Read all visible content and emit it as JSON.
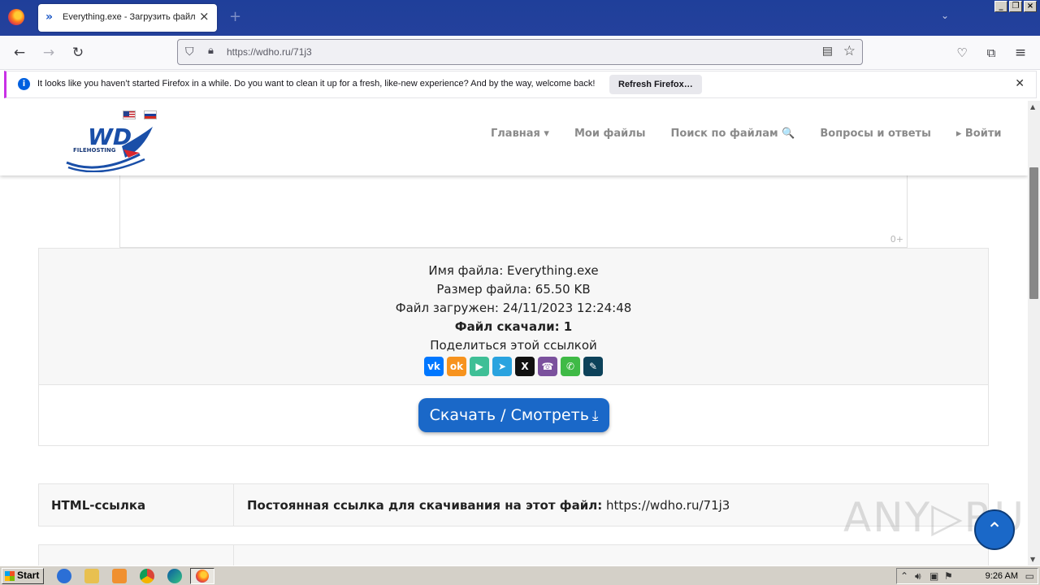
{
  "browser": {
    "tab_title": "Everything.exe - Загрузить файл",
    "url": "https://wdho.ru/71j3",
    "notification": {
      "message": "It looks like you haven’t started Firefox in a while. Do you want to clean it up for a fresh, like-new experience? And by the way, welcome back!",
      "button": "Refresh Firefox…"
    }
  },
  "site": {
    "logo_text": "WD",
    "logo_sub": "FILEHOSTING",
    "menu": [
      {
        "label": "Главная ▾"
      },
      {
        "label": "Мои файлы"
      },
      {
        "label": "Поиск по файлам 🔍"
      },
      {
        "label": "Вопросы и ответы"
      },
      {
        "label": "▸ Войти"
      }
    ],
    "ad_age": "0+"
  },
  "file": {
    "name_line": "Имя файла: Everything.exe",
    "size_line": "Размер файла: 65.50 KB",
    "uploaded_line": "Файл загружен: 24/11/2023 12:24:48",
    "downloads_line": "Файл скачали: 1",
    "share_label": "Поделиться этой ссылкой"
  },
  "share_buttons": [
    {
      "name": "vk",
      "glyph": "vk",
      "color": "#0077ff"
    },
    {
      "name": "odnoklassniki",
      "glyph": "ok",
      "color": "#f7931e"
    },
    {
      "name": "yandex-messenger",
      "glyph": "▶",
      "color": "#3fbf96"
    },
    {
      "name": "telegram",
      "glyph": "➤",
      "color": "#2aa3df"
    },
    {
      "name": "x",
      "glyph": "X",
      "color": "#111111"
    },
    {
      "name": "viber",
      "glyph": "☎",
      "color": "#7b519d"
    },
    {
      "name": "whatsapp",
      "glyph": "✆",
      "color": "#3fba46"
    },
    {
      "name": "livejournal",
      "glyph": "✎",
      "color": "#0d425a"
    }
  ],
  "download_button": "Скачать / Смотреть",
  "table": {
    "row1_key": "HTML-ссылка",
    "row1_label": "Постоянная ссылка для скачивания на этот файл:",
    "row1_value": "https://wdho.ru/71j3"
  },
  "watermark": "ANY▷RUN",
  "taskbar": {
    "start": "Start",
    "clock": "9:26 AM"
  }
}
